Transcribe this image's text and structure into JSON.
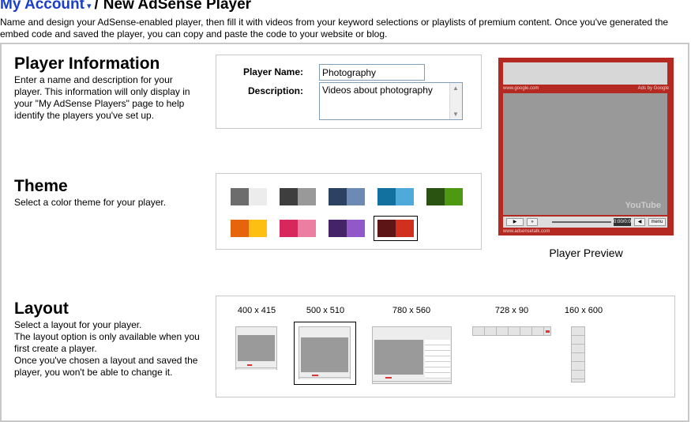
{
  "header": {
    "account_label": "My Account",
    "caret": "▾",
    "separator": "/",
    "title": "New AdSense Player"
  },
  "intro": "Name and design your AdSense-enabled player, then fill it with videos from your keyword selections or playlists of premium content. Once you've generated the embed code and saved the player, you can copy and paste the code to your website or blog.",
  "player_info": {
    "title": "Player Information",
    "description": "Enter a name and description for your player. This information will only display in your \"My AdSense Players\" page to help identify the players you've set up.",
    "name_label": "Player Name:",
    "name_value": "Photography",
    "desc_label": "Description:",
    "desc_value": "Videos about photography"
  },
  "theme": {
    "title": "Theme",
    "description": "Select a color theme for your player.",
    "selected": 9,
    "swatches": [
      {
        "name": "gray-light",
        "c1": "#6d6d6d",
        "c2": "#ececec"
      },
      {
        "name": "gray-dark",
        "c1": "#3e3e3e",
        "c2": "#999999"
      },
      {
        "name": "navy",
        "c1": "#2b4262",
        "c2": "#6d8ab5"
      },
      {
        "name": "blue",
        "c1": "#12719e",
        "c2": "#4fa9da"
      },
      {
        "name": "green",
        "c1": "#2a5210",
        "c2": "#4d9a12"
      },
      {
        "name": "orange",
        "c1": "#e5640c",
        "c2": "#fcbf12"
      },
      {
        "name": "pink",
        "c1": "#d8275d",
        "c2": "#ec7ea1"
      },
      {
        "name": "purple",
        "c1": "#452369",
        "c2": "#9058c8"
      },
      {
        "name": "red",
        "c1": "#5e1516",
        "c2": "#d1301f"
      }
    ]
  },
  "preview": {
    "label": "Player Preview",
    "url_left": "www.google.com",
    "url_right": "Ads by Google",
    "youtube": "YouTube",
    "time": "0:00/0:00",
    "menu": "menu",
    "footer": "www.adsensetalk.com"
  },
  "layout": {
    "title": "Layout",
    "description": [
      "Select a layout for your player.",
      "The layout option is only available when you first create a player.",
      "Once you've chosen a layout and saved the player, you won't be able to change it."
    ],
    "options": [
      "400 x 415",
      "500 x 510",
      "780 x 560",
      "728 x 90",
      "160 x 600"
    ],
    "selected": 1
  },
  "colors": {
    "link": "#1a3ec9",
    "border": "#c8c8c8",
    "preview_frame": "#b42a23"
  }
}
